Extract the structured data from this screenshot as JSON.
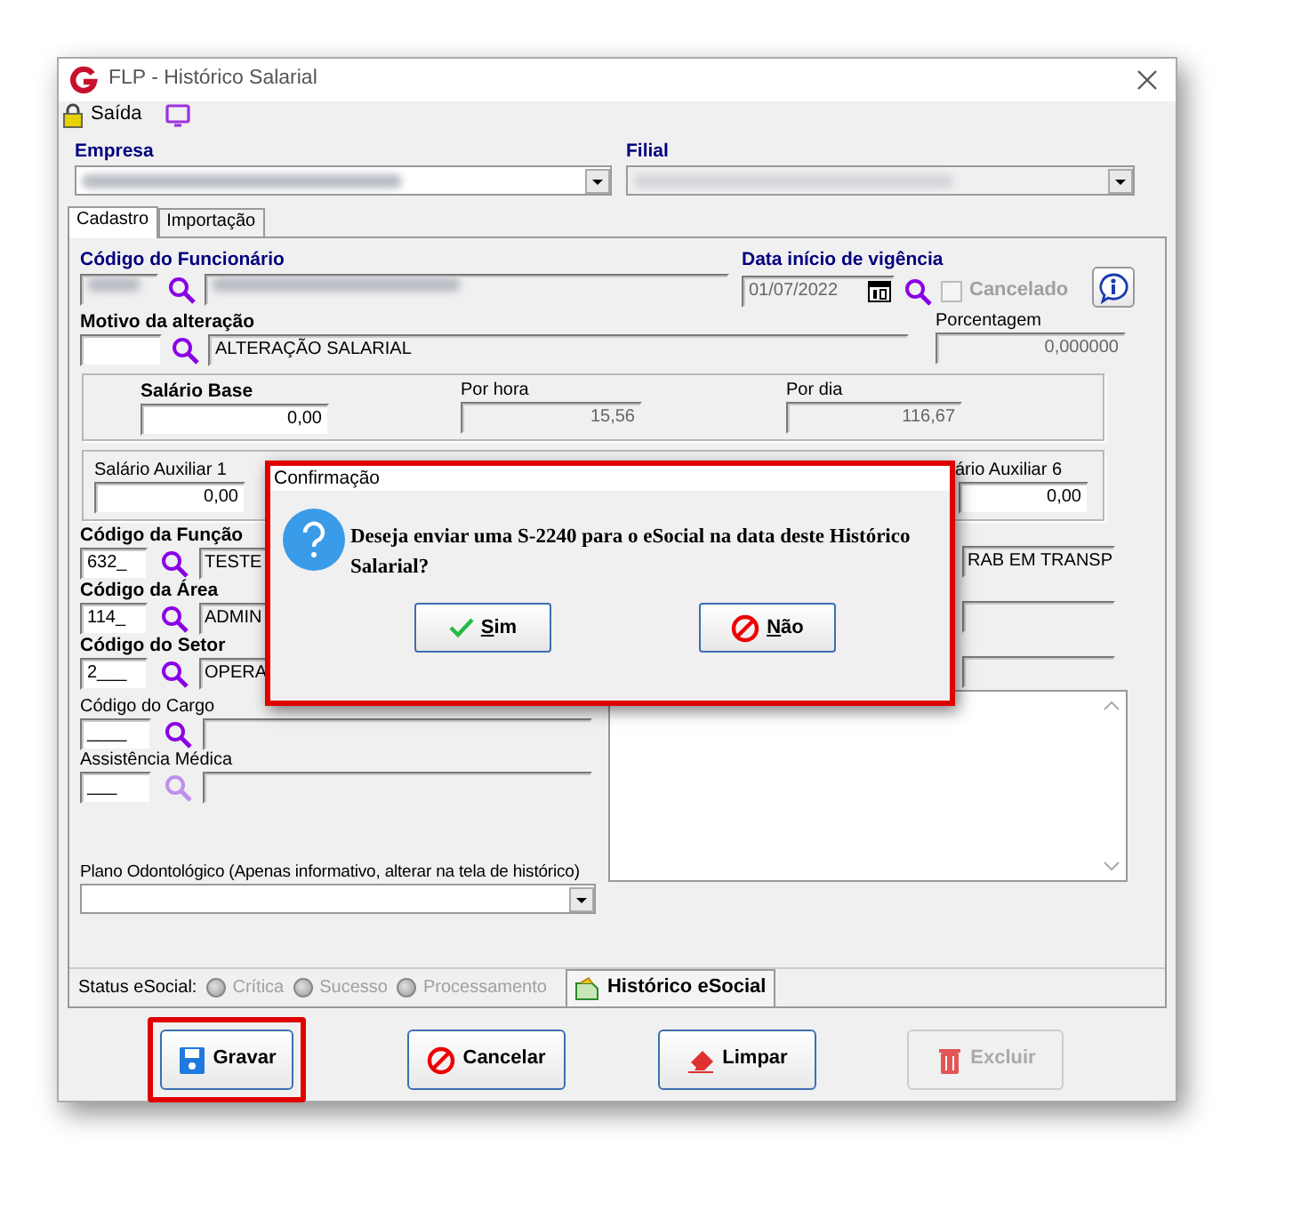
{
  "window": {
    "title": "FLP - Histórico Salarial"
  },
  "toolbar": {
    "exit_label": "Saída"
  },
  "company": {
    "label": "Empresa",
    "redacted": true
  },
  "branch": {
    "label": "Filial",
    "redacted": true,
    "disabled": true
  },
  "tabs": [
    {
      "label": "Cadastro",
      "selected": true
    },
    {
      "label": "Importação",
      "selected": false
    }
  ],
  "employee": {
    "label": "Código do Funcionário",
    "redacted": true
  },
  "start_date": {
    "label": "Data início de vigência",
    "value": "01/07/2022"
  },
  "cancelled": {
    "label": "Cancelado",
    "checked": false,
    "disabled": true
  },
  "reason": {
    "label": "Motivo da alteração",
    "value": "ALTERAÇÃO SALARIAL"
  },
  "percentage": {
    "label": "Porcentagem",
    "value": "0,000000"
  },
  "salary": [
    {
      "label": "Salário Base",
      "value": "0,00",
      "bold": true,
      "readonly": false
    },
    {
      "label": "Por hora",
      "value": "15,56",
      "bold": false,
      "readonly": true
    },
    {
      "label": "Por dia",
      "value": "116,67",
      "bold": false,
      "readonly": true
    }
  ],
  "aux_salaries": [
    {
      "label": "Salário Auxiliar 1",
      "value": "0,00"
    },
    {
      "label": "ário Auxiliar 6",
      "value": "0,00"
    }
  ],
  "codes": [
    {
      "label": "Código da Função",
      "bold": true,
      "code": "632_",
      "value": "TESTE",
      "lookup_enabled": true,
      "extra": "RAB EM TRANSP"
    },
    {
      "label": "Código da Área",
      "bold": true,
      "code": "114_",
      "value": "ADMIN",
      "lookup_enabled": true,
      "extra_field": true
    },
    {
      "label": "Código do Setor",
      "bold": true,
      "code": "2___",
      "value": "OPERA",
      "lookup_enabled": true,
      "extra_field": true
    },
    {
      "label": "Código do Cargo",
      "bold": false,
      "code": "____",
      "lookup_enabled": true
    },
    {
      "label": "Assistência Médica",
      "bold": false,
      "code": "___",
      "lookup_enabled": false
    }
  ],
  "dental_plan": {
    "label": "Plano Odontológico (Apenas informativo, alterar na tela de histórico)"
  },
  "status": {
    "label": "Status eSocial:",
    "options": [
      {
        "label": "Crítica",
        "disabled": true
      },
      {
        "label": "Sucesso",
        "disabled": true
      },
      {
        "label": "Processamento",
        "disabled": true
      }
    ],
    "history_button": "Histórico eSocial"
  },
  "buttons": [
    {
      "label": "Gravar",
      "kind": "save",
      "highlighted": true,
      "disabled": false
    },
    {
      "label": "Cancelar",
      "kind": "cancel",
      "highlighted": false,
      "disabled": false
    },
    {
      "label": "Limpar",
      "kind": "clear",
      "highlighted": false,
      "disabled": false
    },
    {
      "label": "Excluir",
      "kind": "delete",
      "highlighted": false,
      "disabled": true
    }
  ],
  "dialog": {
    "title": "Confirmação",
    "message": "Deseja enviar uma S-2240 para o eSocial na data deste Histórico Salarial?",
    "highlighted": true,
    "buttons": [
      {
        "label": "Sim",
        "kind": "yes"
      },
      {
        "label": "Não",
        "kind": "no"
      }
    ]
  }
}
